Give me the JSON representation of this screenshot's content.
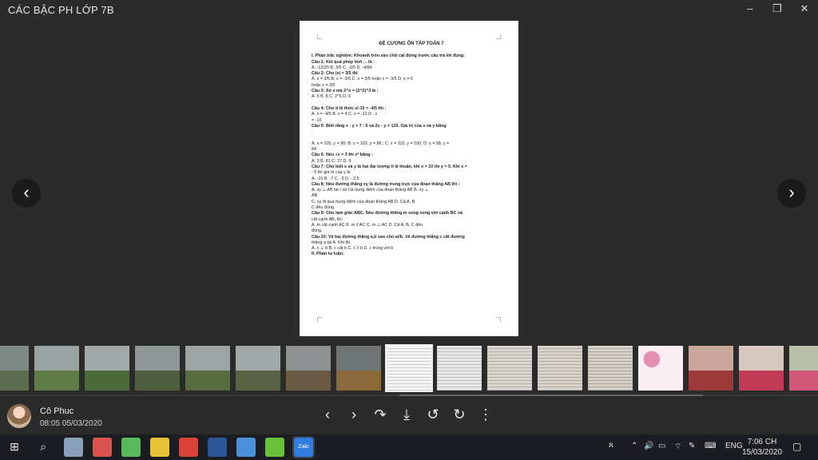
{
  "window": {
    "title": "CÁC BẬC PH LỚP 7B",
    "minimize": "–",
    "restore": "❐",
    "close": "✕"
  },
  "viewer": {
    "prev": "‹",
    "next": "›"
  },
  "document": {
    "heading": "ĐỀ CƯƠNG ÔN TẬP TOÁN 7",
    "lines": [
      "I. Phần trắc nghiệm: Khoanh tròn vào chữ cái đứng trước câu trả lời đúng:",
      "Câu 1: Kết quả phép tính ... là :",
      "A.  -12/20        B.  3/5         C.  -3/5            D.  -4/84",
      "Câu 2: Cho  |x| = 3/5  thì",
      "A.  x = 3/5     B.  x = -3/5       C. x = 3/5  hoặc x = -3/5     D. x = 0",
      "hoặc x = 3/5",
      "Câu 3: Số x mà 2^x = (2^2)^3 là :",
      "A.  5                B.  8              C.   2^6                                D.   6",
      "",
      "Câu 4: Cho tỉ lệ thức  x/-15 = -4/5  thì :",
      "A.   x = -4/5           B.  x = 4           C.   x = -12                     D .   x",
      "= -10",
      "Câu 5:   Biết rằng   x : y = 7 : 6   và   2x - y   = 120. Giá trị của x và y   bằng",
      ":",
      "",
      "A. x = 105, y = 90;   B. x = 103, y = 86 ;   C. x = 110, y = 100;   D. x = 98, y =",
      "84",
      "Câu 6: Nếu √x = 3 thì x² bằng :",
      "A.    3              B.    81                  C.     27                     D. 9",
      "Câu 7: Cho biết x và y là hai đại lượng tỉ lệ thuận, khi x = 10 thì y = 5. Khi x =",
      "- 5 thì giá trị của y là",
      "A.   -10          B.  -7           C.   -3             D.   - 2,5",
      "Câu 8: Nếu đường thẳng xy là đường trung trực của đoạn thẳng AB thì :",
      "A. xy ⊥ AB tại I và I là trung điểm của đoạn thẳng AB             B. xy ⊥",
      "AB",
      "C. xy đi qua trung điểm của đoạn thẳng AB                                D. Cả A, B,",
      "C đều đúng",
      "Câu 9: Cho tam giác ABC. Nếu đường thẳng m song song với cạnh BC và",
      "cắt cạnh AB, thì:",
      "A. m cắt cạnh AC       B. m // AC        C. m ⊥ AC       D. Cả A, B, C đều",
      "đúng.",
      "Câu 10: Vẽ hai đường thẳng a,b sao cho a//b. Vẽ đường thẳng c cắt đường",
      "thẳng a tại A. Khi đó",
      "A.   c ⊥ b      B.   c cắt b       C.   c // b         D. c trùng với b",
      "II. Phần tự luận:"
    ]
  },
  "filmstrip": {
    "selected_index": 8,
    "thumbs": [
      {
        "kind": "photo",
        "colors": [
          "#7d8a86",
          "#5d6b4f"
        ]
      },
      {
        "kind": "photo",
        "colors": [
          "#9aa3a3",
          "#5f7b45"
        ]
      },
      {
        "kind": "photo",
        "colors": [
          "#a1a8a7",
          "#4c6a3a"
        ]
      },
      {
        "kind": "photo",
        "colors": [
          "#8f9896",
          "#4f5f3d"
        ]
      },
      {
        "kind": "photo",
        "colors": [
          "#9ea5a4",
          "#566b40"
        ]
      },
      {
        "kind": "photo",
        "colors": [
          "#a3a9a8",
          "#5a6444"
        ]
      },
      {
        "kind": "photo",
        "colors": [
          "#8e9191",
          "#6b5b44"
        ]
      },
      {
        "kind": "photo",
        "colors": [
          "#6f7475",
          "#8a6a3a"
        ]
      },
      {
        "kind": "doc",
        "colors": [
          "#f4f4f4",
          "#cfcfcf"
        ]
      },
      {
        "kind": "doc",
        "colors": [
          "#e6e6e6",
          "#bdbdbd"
        ]
      },
      {
        "kind": "doc",
        "colors": [
          "#d9d6cf",
          "#b5b0a8"
        ]
      },
      {
        "kind": "doc",
        "colors": [
          "#d8d4cc",
          "#b0aba2"
        ]
      },
      {
        "kind": "doc",
        "colors": [
          "#d6d2ca",
          "#aaa59c"
        ]
      },
      {
        "kind": "card",
        "colors": [
          "#fbeef2",
          "#e58fb0"
        ]
      },
      {
        "kind": "photo",
        "colors": [
          "#c9a79a",
          "#9b3a3a"
        ]
      },
      {
        "kind": "photo",
        "colors": [
          "#d8c9c0",
          "#c23a55"
        ]
      },
      {
        "kind": "photo",
        "colors": [
          "#b9c2a8",
          "#d2587a"
        ]
      }
    ]
  },
  "bottom": {
    "user_name": "Cô Phuc",
    "timestamp": "08:05 05/03/2020",
    "tools": [
      "‹",
      "›",
      "↷",
      "⤓",
      "↺",
      "↻",
      "⋮"
    ],
    "tool_names": [
      "prev-icon",
      "next-icon",
      "share-icon",
      "download-icon",
      "rotate-left-icon",
      "rotate-right-icon",
      "more-icon"
    ]
  },
  "taskbar": {
    "apps": [
      {
        "name": "recycle-bin-icon",
        "color": "#8aa0b8"
      },
      {
        "name": "app-puzzle-icon",
        "color": "#d9534f"
      },
      {
        "name": "app-green-icon",
        "color": "#5cb85c"
      },
      {
        "name": "chrome-icon",
        "color": "#e8c33a"
      },
      {
        "name": "shield-app-icon",
        "color": "#d9433a"
      },
      {
        "name": "word-icon",
        "color": "#2b5797"
      },
      {
        "name": "browser-blue-icon",
        "color": "#4a90d9"
      },
      {
        "name": "game-icon",
        "color": "#6cbf3a"
      },
      {
        "name": "zalo-icon",
        "color": "#2f7de1"
      }
    ],
    "zalo_label": "Zalo",
    "tray": {
      "lang": "ENG"
    },
    "time": "7:06 CH",
    "date": "15/03/2020"
  }
}
